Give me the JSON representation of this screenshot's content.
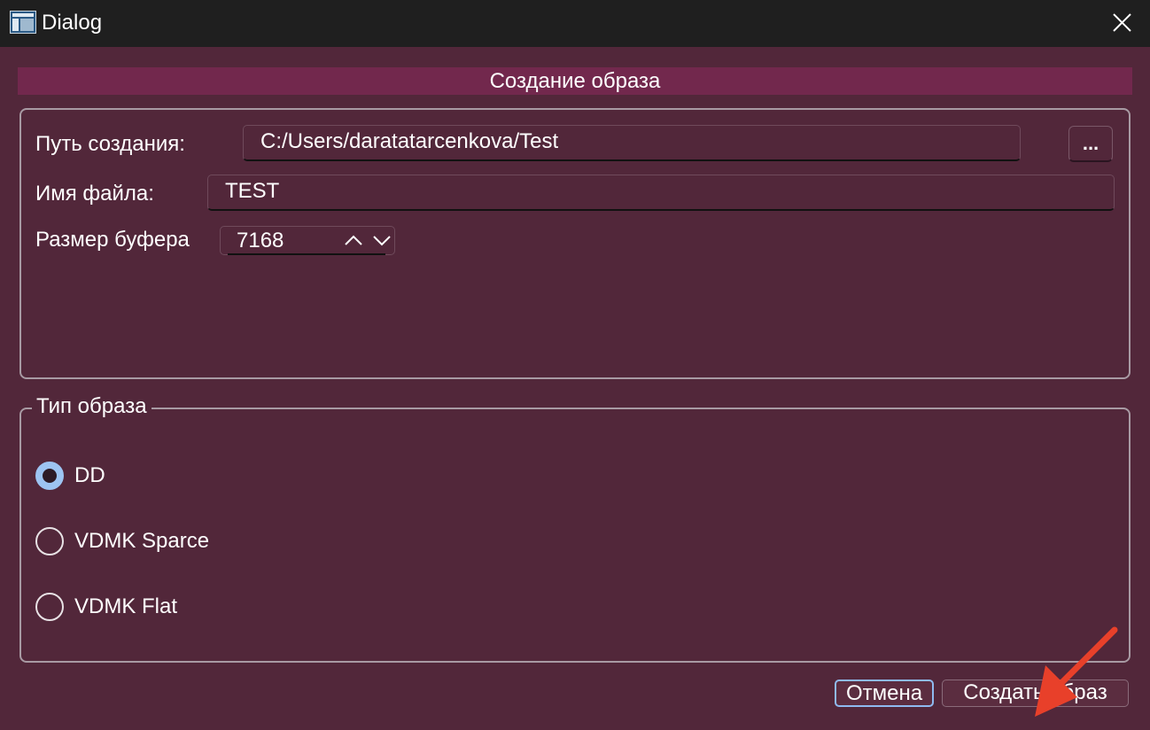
{
  "window": {
    "title": "Dialog",
    "icon": "app-window-icon",
    "close_icon": "close-icon"
  },
  "banner": {
    "title": "Создание образа"
  },
  "settings": {
    "path_label": "Путь создания:",
    "path_value": "C:/Users/daratatarcenkova/Test",
    "browse_label": "...",
    "filename_label": "Имя файла:",
    "filename_value": "TEST",
    "buffer_label": "Размер буфера",
    "buffer_value": "7168",
    "buffer_up_icon": "chevron-up-icon",
    "buffer_down_icon": "chevron-down-icon"
  },
  "image_type": {
    "legend": "Тип образа",
    "selected": "DD",
    "options": [
      {
        "label": "DD",
        "checked": true
      },
      {
        "label": "VDMK Sparce",
        "checked": false
      },
      {
        "label": "VDMK Flat",
        "checked": false
      }
    ]
  },
  "buttons": {
    "cancel_label": "Отмена",
    "create_label": "Создать образ"
  },
  "annotation": {
    "icon": "red-arrow-icon",
    "color": "#e8402a"
  },
  "colors": {
    "titlebar": "#1f1f1f",
    "background": "#52273a",
    "banner": "#72284d",
    "radio_checked": "#9dc4f2",
    "focus_border": "#8fbaf0"
  }
}
